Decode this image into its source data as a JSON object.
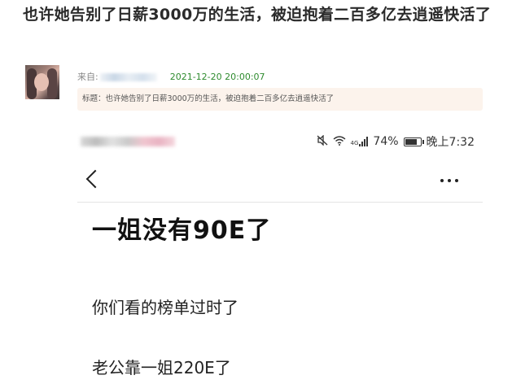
{
  "post": {
    "title": "也许她告别了日薪3000万的生活，被迫抱着二百多亿去逍遥快活了",
    "from_label": "来自:",
    "date": "2021-12-20 20:00:07",
    "subject": "标题：也许她告别了日薪3000万的生活，被迫抱着二百多亿去逍遥快活了"
  },
  "phone": {
    "status": {
      "network": "4G",
      "battery_percent": "74%",
      "time": "晚上7:32",
      "battery_level": 0.74
    },
    "headline": "一姐没有90E了",
    "lines": [
      "你们看的榜单过时了",
      "老公靠一姐220E了"
    ]
  },
  "icons": {
    "mute": "mute-icon",
    "wifi": "wifi-icon",
    "signal": "signal-icon",
    "battery": "battery-icon",
    "back": "back-chevron-icon",
    "more": "more-dots-icon"
  },
  "colors": {
    "date": "#2e8b2e",
    "subject_bg": "#fcf3ec"
  }
}
